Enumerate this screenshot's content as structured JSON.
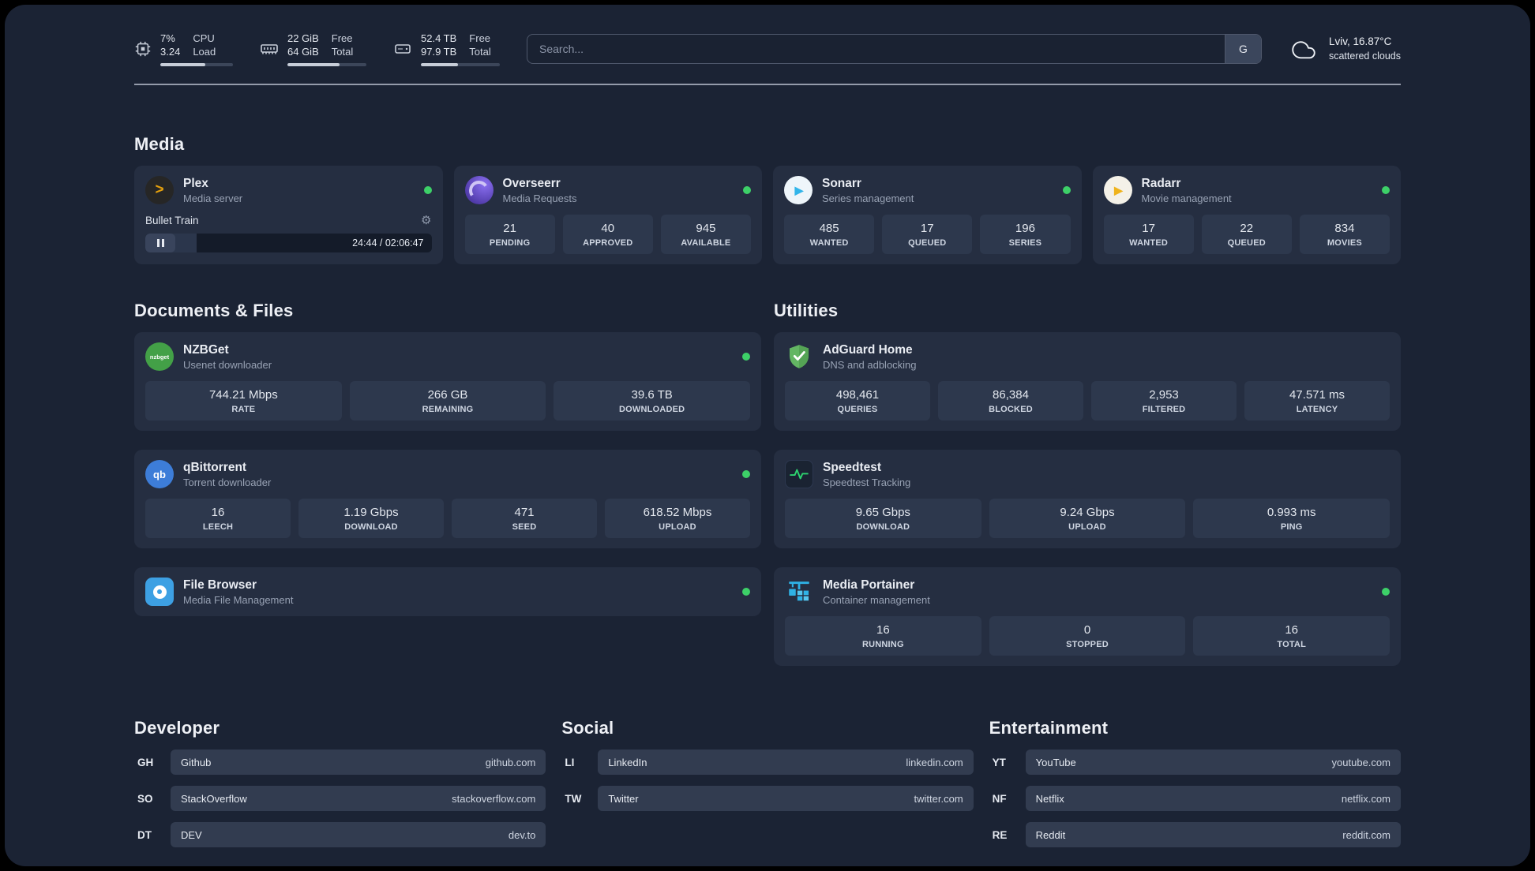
{
  "topbar": {
    "cpu": {
      "value1": "7%",
      "value2": "3.24",
      "label1": "CPU",
      "label2": "Load"
    },
    "ram": {
      "value1": "22 GiB",
      "value2": "64 GiB",
      "label1": "Free",
      "label2": "Total"
    },
    "disk": {
      "value1": "52.4 TB",
      "value2": "97.9 TB",
      "label1": "Free",
      "label2": "Total"
    },
    "search": {
      "placeholder": "Search...",
      "button_label": "G"
    },
    "weather": {
      "location": "Lviv, 16.87°C",
      "condition": "scattered clouds"
    }
  },
  "media": {
    "title": "Media",
    "plex": {
      "name": "Plex",
      "desc": "Media server",
      "icon_glyph": ">",
      "now_playing": "Bullet Train",
      "time": "24:44 / 02:06:47"
    },
    "overseerr": {
      "name": "Overseerr",
      "desc": "Media Requests",
      "stats": [
        {
          "value": "21",
          "label": "PENDING"
        },
        {
          "value": "40",
          "label": "APPROVED"
        },
        {
          "value": "945",
          "label": "AVAILABLE"
        }
      ]
    },
    "sonarr": {
      "name": "Sonarr",
      "desc": "Series management",
      "icon_glyph": "▶",
      "stats": [
        {
          "value": "485",
          "label": "WANTED"
        },
        {
          "value": "17",
          "label": "QUEUED"
        },
        {
          "value": "196",
          "label": "SERIES"
        }
      ]
    },
    "radarr": {
      "name": "Radarr",
      "desc": "Movie management",
      "icon_glyph": "▶",
      "stats": [
        {
          "value": "17",
          "label": "WANTED"
        },
        {
          "value": "22",
          "label": "QUEUED"
        },
        {
          "value": "834",
          "label": "MOVIES"
        }
      ]
    }
  },
  "documents": {
    "title": "Documents & Files",
    "nzbget": {
      "name": "NZBGet",
      "desc": "Usenet downloader",
      "icon_text": "nzbget",
      "stats": [
        {
          "value": "744.21 Mbps",
          "label": "RATE"
        },
        {
          "value": "266 GB",
          "label": "REMAINING"
        },
        {
          "value": "39.6 TB",
          "label": "DOWNLOADED"
        }
      ]
    },
    "qbittorrent": {
      "name": "qBittorrent",
      "desc": "Torrent downloader",
      "icon_text": "qb",
      "stats": [
        {
          "value": "16",
          "label": "LEECH"
        },
        {
          "value": "1.19 Gbps",
          "label": "DOWNLOAD"
        },
        {
          "value": "471",
          "label": "SEED"
        },
        {
          "value": "618.52 Mbps",
          "label": "UPLOAD"
        }
      ]
    },
    "filebrowser": {
      "name": "File Browser",
      "desc": "Media File Management"
    }
  },
  "utilities": {
    "title": "Utilities",
    "adguard": {
      "name": "AdGuard Home",
      "desc": "DNS and adblocking",
      "stats": [
        {
          "value": "498,461",
          "label": "QUERIES"
        },
        {
          "value": "86,384",
          "label": "BLOCKED"
        },
        {
          "value": "2,953",
          "label": "FILTERED"
        },
        {
          "value": "47.571 ms",
          "label": "LATENCY"
        }
      ]
    },
    "speedtest": {
      "name": "Speedtest",
      "desc": "Speedtest Tracking",
      "stats": [
        {
          "value": "9.65 Gbps",
          "label": "DOWNLOAD"
        },
        {
          "value": "9.24 Gbps",
          "label": "UPLOAD"
        },
        {
          "value": "0.993 ms",
          "label": "PING"
        }
      ]
    },
    "portainer": {
      "name": "Media Portainer",
      "desc": "Container management",
      "stats": [
        {
          "value": "16",
          "label": "RUNNING"
        },
        {
          "value": "0",
          "label": "STOPPED"
        },
        {
          "value": "16",
          "label": "TOTAL"
        }
      ]
    }
  },
  "links": {
    "developer": {
      "title": "Developer",
      "items": [
        {
          "abbr": "GH",
          "name": "Github",
          "url": "github.com"
        },
        {
          "abbr": "SO",
          "name": "StackOverflow",
          "url": "stackoverflow.com"
        },
        {
          "abbr": "DT",
          "name": "DEV",
          "url": "dev.to"
        }
      ]
    },
    "social": {
      "title": "Social",
      "items": [
        {
          "abbr": "LI",
          "name": "LinkedIn",
          "url": "linkedin.com"
        },
        {
          "abbr": "TW",
          "name": "Twitter",
          "url": "twitter.com"
        }
      ]
    },
    "entertainment": {
      "title": "Entertainment",
      "items": [
        {
          "abbr": "YT",
          "name": "YouTube",
          "url": "youtube.com"
        },
        {
          "abbr": "NF",
          "name": "Netflix",
          "url": "netflix.com"
        },
        {
          "abbr": "RE",
          "name": "Reddit",
          "url": "reddit.com"
        }
      ]
    }
  },
  "colors": {
    "status_online": "#3dd068",
    "accent_plex": "#e5a00d"
  }
}
